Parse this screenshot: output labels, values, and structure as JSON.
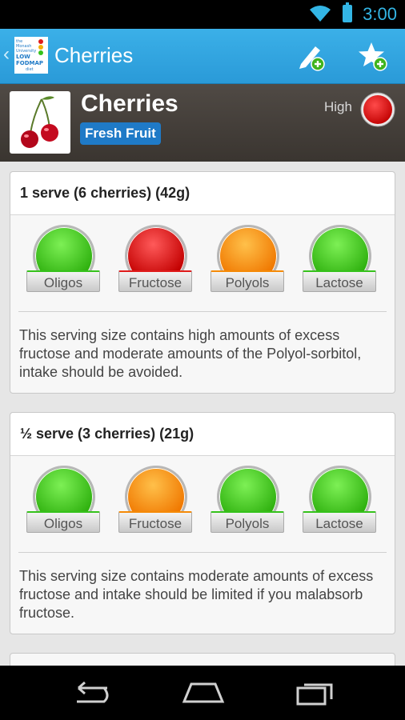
{
  "status_bar": {
    "time": "3:00"
  },
  "action_bar": {
    "title": "Cherries",
    "logo_text": [
      "the",
      "Monash",
      "University",
      "LOW",
      "FODMAP",
      "diet"
    ]
  },
  "food": {
    "name": "Cherries",
    "category": "Fresh Fruit",
    "rating_label": "High",
    "rating_color": "#e01b1b"
  },
  "colors": {
    "green": "#35c21b",
    "red": "#e01b1b",
    "orange": "#f58a07"
  },
  "servings": [
    {
      "title": "1 serve (6 cherries) (42g)",
      "lights": [
        {
          "label": "Oligos",
          "level": "green"
        },
        {
          "label": "Fructose",
          "level": "red"
        },
        {
          "label": "Polyols",
          "level": "orange"
        },
        {
          "label": "Lactose",
          "level": "green"
        }
      ],
      "description": "This serving size contains high amounts of excess fructose and moderate amounts of the Polyol-sorbitol, intake should be avoided."
    },
    {
      "title": "½ serve (3 cherries) (21g)",
      "lights": [
        {
          "label": "Oligos",
          "level": "green"
        },
        {
          "label": "Fructose",
          "level": "orange"
        },
        {
          "label": "Polyols",
          "level": "green"
        },
        {
          "label": "Lactose",
          "level": "green"
        }
      ],
      "description": "This serving size contains moderate amounts of excess fructose and intake should be limited if you malabsorb fructose."
    }
  ]
}
